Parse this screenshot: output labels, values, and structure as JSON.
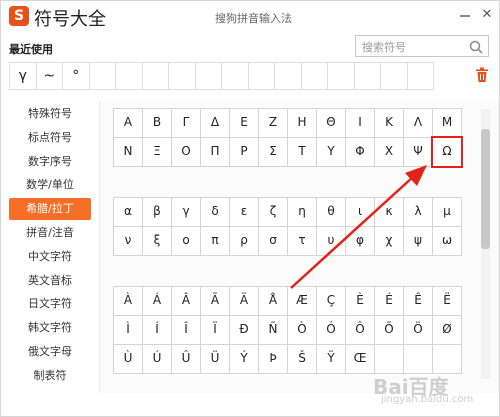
{
  "titlebar": {
    "logo_letter": "S",
    "title": "符号大全",
    "subtitle": "搜狗拼音输入法",
    "close_glyph": "✕"
  },
  "recent": {
    "label": "最近使用",
    "items": [
      "γ",
      "~",
      "°",
      "",
      "",
      "",
      "",
      "",
      "",
      "",
      "",
      "",
      "",
      "",
      "",
      ""
    ]
  },
  "search": {
    "placeholder": "搜索符号"
  },
  "sidebar": {
    "items": [
      {
        "label": "特殊符号"
      },
      {
        "label": "标点符号"
      },
      {
        "label": "数字序号"
      },
      {
        "label": "数学/单位"
      },
      {
        "label": "希腊/拉丁"
      },
      {
        "label": "拼音/注音"
      },
      {
        "label": "中文字符"
      },
      {
        "label": "英文音标"
      },
      {
        "label": "日文字符"
      },
      {
        "label": "韩文字符"
      },
      {
        "label": "俄文字母"
      },
      {
        "label": "制表符"
      }
    ],
    "active_index": 4
  },
  "greek_upper": [
    [
      "Α",
      "Β",
      "Γ",
      "Δ",
      "Ε",
      "Ζ",
      "Η",
      "Θ",
      "Ι",
      "Κ",
      "Λ",
      "Μ"
    ],
    [
      "Ν",
      "Ξ",
      "Ο",
      "Π",
      "Ρ",
      "Σ",
      "Τ",
      "Υ",
      "Φ",
      "Χ",
      "Ψ",
      "Ω"
    ]
  ],
  "greek_lower": [
    [
      "α",
      "β",
      "γ",
      "δ",
      "ε",
      "ζ",
      "η",
      "θ",
      "ι",
      "κ",
      "λ",
      "μ"
    ],
    [
      "ν",
      "ξ",
      "ο",
      "π",
      "ρ",
      "σ",
      "τ",
      "υ",
      "φ",
      "χ",
      "ψ",
      "ω"
    ]
  ],
  "latin": [
    [
      "À",
      "Á",
      "Â",
      "Ã",
      "Ä",
      "Å",
      "Æ",
      "Ç",
      "È",
      "É",
      "Ê",
      "Ë"
    ],
    [
      "Ì",
      "Í",
      "Î",
      "Ï",
      "Ð",
      "Ñ",
      "Ò",
      "Ó",
      "Ô",
      "Õ",
      "Ö",
      "Ø"
    ],
    [
      "Ù",
      "Ú",
      "Û",
      "Ü",
      "Ý",
      "Þ",
      "Š",
      "Ÿ",
      "Œ",
      "",
      "",
      ""
    ]
  ],
  "highlighted_symbol": "Ω",
  "watermark": {
    "main": "Bai百度",
    "sub": "jingyan.baidu.com"
  },
  "colors": {
    "accent": "#f46e28",
    "highlight": "#e2231a",
    "logo": "#e8501c"
  }
}
